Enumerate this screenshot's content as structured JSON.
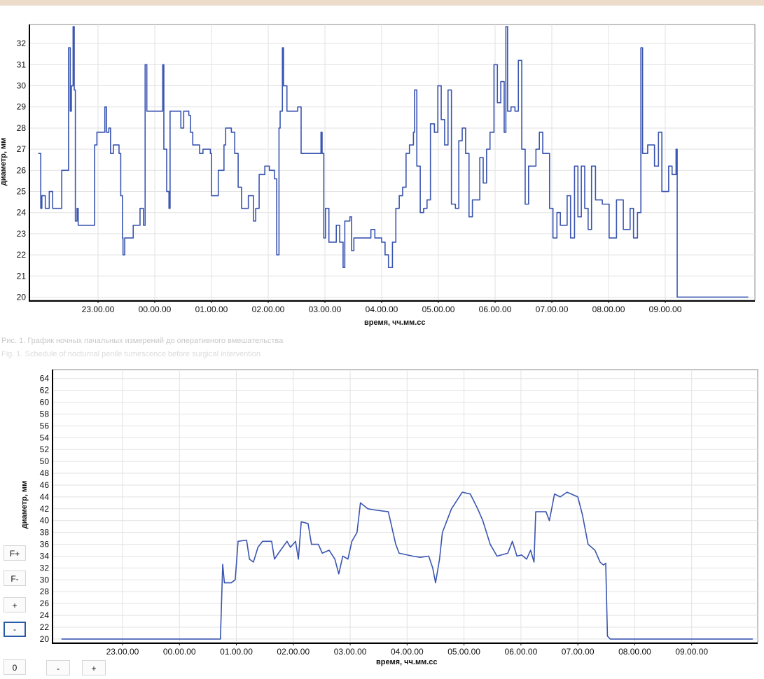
{
  "captions": {
    "ru": "Рис. 1. График ночных пачальных измерений до оперативного вмешательства",
    "en": "Fig. 1. Schedule of nocturnal penile tumescence before surgical intervention"
  },
  "controls": {
    "f_plus": "F+",
    "f_minus": "F-",
    "plus": "+",
    "minus": "-",
    "zero": "0",
    "x_minus": "-",
    "x_plus": "+"
  },
  "colors": {
    "line": "#3a55b0",
    "grid": "#e2e2e2",
    "topbar": "#eedccb"
  },
  "chart_data": [
    {
      "type": "line",
      "title": "",
      "xlabel": "время, чч.мм.сс",
      "ylabel": "диаметр, мм",
      "x_unit": "hours relative to 23:00",
      "xlim": [
        -1.21,
        11.58
      ],
      "ylim": [
        19.85,
        32.9
      ],
      "grid": true,
      "xticks": [
        0,
        1,
        2,
        3,
        4,
        5,
        6,
        7,
        8,
        9,
        10
      ],
      "xtick_labels": [
        "23.00.00",
        "00.00.00",
        "01.00.00",
        "02.00.00",
        "03.00.00",
        "04.00.00",
        "05.00.00",
        "06.00.00",
        "07.00.00",
        "08.00.00",
        "09.00.00"
      ],
      "yticks": [
        20,
        21,
        22,
        23,
        24,
        25,
        26,
        27,
        28,
        29,
        30,
        31,
        32
      ],
      "ytick_labels": [
        "20",
        "21",
        "22",
        "23",
        "24",
        "25",
        "26",
        "27",
        "28",
        "29",
        "30",
        "31",
        "32"
      ],
      "series": [
        {
          "name": "diameter",
          "x": [
            -1.05,
            -1.01,
            -0.99,
            -0.93,
            -0.86,
            -0.8,
            -0.68,
            -0.64,
            -0.56,
            -0.52,
            -0.49,
            -0.47,
            -0.44,
            -0.42,
            -0.4,
            -0.37,
            -0.35,
            -0.09,
            -0.06,
            -0.02,
            0.12,
            0.15,
            0.19,
            0.22,
            0.27,
            0.37,
            0.4,
            0.43,
            0.44,
            0.47,
            0.62,
            0.74,
            0.8,
            0.83,
            0.86,
            1.11,
            1.14,
            1.16,
            1.21,
            1.25,
            1.27,
            1.42,
            1.46,
            1.51,
            1.6,
            1.63,
            1.67,
            1.79,
            1.85,
            1.98,
            2.0,
            2.07,
            2.12,
            2.22,
            2.25,
            2.35,
            2.41,
            2.47,
            2.53,
            2.65,
            2.74,
            2.78,
            2.84,
            2.94,
            3.02,
            3.11,
            3.15,
            3.19,
            3.21,
            3.25,
            3.27,
            3.33,
            3.46,
            3.52,
            3.58,
            3.89,
            3.93,
            3.95,
            3.98,
            4.01,
            4.07,
            4.2,
            4.26,
            4.32,
            4.35,
            4.44,
            4.47,
            4.51,
            4.69,
            4.81,
            4.88,
            5.0,
            5.06,
            5.12,
            5.19,
            5.25,
            5.31,
            5.37,
            5.43,
            5.49,
            5.56,
            5.58,
            5.62,
            5.68,
            5.74,
            5.8,
            5.86,
            5.93,
            5.99,
            6.05,
            6.11,
            6.17,
            6.23,
            6.3,
            6.36,
            6.42,
            6.48,
            6.54,
            6.6,
            6.73,
            6.79,
            6.85,
            6.91,
            6.98,
            7.04,
            7.1,
            7.16,
            7.19,
            7.22,
            7.28,
            7.35,
            7.41,
            7.47,
            7.53,
            7.59,
            7.72,
            7.78,
            7.84,
            7.9,
            7.96,
            8.02,
            8.09,
            8.15,
            8.27,
            8.33,
            8.4,
            8.46,
            8.52,
            8.58,
            8.64,
            8.7,
            8.77,
            8.89,
            9.01,
            9.14,
            9.26,
            9.38,
            9.44,
            9.51,
            9.57,
            9.6,
            9.69,
            9.81,
            9.88,
            9.94,
            10.06,
            10.12,
            10.19,
            10.21,
            11.46
          ],
          "y": [
            26.8,
            24.2,
            24.8,
            24.2,
            25,
            24.2,
            24.2,
            26,
            26,
            31.8,
            28.8,
            30,
            32.8,
            29.8,
            23.6,
            24.2,
            23.4,
            23.4,
            27.2,
            27.8,
            29,
            27.8,
            28,
            26.8,
            27.2,
            26.8,
            24.8,
            22.8,
            22,
            22.8,
            23.4,
            24.2,
            23.4,
            31,
            28.8,
            28.8,
            31,
            27,
            25,
            24.2,
            28.8,
            28.8,
            28,
            28.8,
            28.6,
            27.8,
            27.2,
            26.8,
            27,
            26.8,
            24.8,
            24.8,
            26,
            27.2,
            28,
            27.8,
            26.8,
            25.2,
            24.2,
            24.8,
            23.6,
            24.2,
            25.8,
            26.2,
            26,
            25.6,
            22,
            28,
            28.8,
            31.8,
            30,
            28.8,
            28.8,
            29,
            26.8,
            26.8,
            27.8,
            26.8,
            22.8,
            24.2,
            22.6,
            23.4,
            22.6,
            21.4,
            23.6,
            23.8,
            22.2,
            22.8,
            22.8,
            23.2,
            22.8,
            22.6,
            22,
            21.4,
            22.6,
            24.2,
            24.8,
            25.2,
            26.8,
            27.2,
            27.8,
            29.8,
            26.2,
            24,
            24.2,
            24.6,
            28.2,
            27.8,
            30,
            28.4,
            27.2,
            29.8,
            24.4,
            24.2,
            27.4,
            28,
            26.8,
            23.8,
            24.6,
            26.6,
            25.4,
            27,
            27.8,
            31,
            29.2,
            30.2,
            27.8,
            32.8,
            28.8,
            29,
            28.8,
            31.2,
            27,
            24.4,
            26.2,
            27,
            27.8,
            26.8,
            26.8,
            24.2,
            22.8,
            24,
            23.4,
            24.8,
            22.8,
            26.2,
            23.8,
            26.2,
            24.2,
            23.2,
            26.2,
            24.6,
            24.4,
            22.8,
            24.6,
            23.2,
            24.2,
            22.8,
            24,
            31.8,
            26.8,
            27.2,
            26.2,
            27.8,
            25,
            26.2,
            25.8,
            27,
            20,
            20
          ]
        }
      ]
    },
    {
      "type": "line",
      "title": "",
      "xlabel": "время, чч.мм.сс",
      "ylabel": "диаметр, мм",
      "x_unit": "hours relative to 23:00",
      "xlim": [
        -1.23,
        11.16
      ],
      "ylim": [
        19.4,
        65.5
      ],
      "grid": true,
      "xticks": [
        0,
        1,
        2,
        3,
        4,
        5,
        6,
        7,
        8,
        9,
        10
      ],
      "xtick_labels": [
        "23.00.00",
        "00.00.00",
        "01.00.00",
        "02.00.00",
        "03.00.00",
        "04.00.00",
        "05.00.00",
        "06.00.00",
        "07.00.00",
        "08.00.00",
        "09.00.00"
      ],
      "yticks": [
        20,
        22,
        24,
        26,
        28,
        30,
        32,
        34,
        36,
        38,
        40,
        42,
        44,
        46,
        48,
        50,
        52,
        54,
        56,
        58,
        60,
        62,
        64
      ],
      "ytick_labels": [
        "20",
        "22",
        "24",
        "26",
        "28",
        "30",
        "32",
        "34",
        "36",
        "38",
        "40",
        "42",
        "44",
        "46",
        "48",
        "50",
        "52",
        "54",
        "56",
        "58",
        "60",
        "62",
        "64"
      ],
      "series": [
        {
          "name": "diameter",
          "x": [
            -1.07,
            1.72,
            1.76,
            1.79,
            1.91,
            1.98,
            2.03,
            2.18,
            2.23,
            2.3,
            2.38,
            2.46,
            2.62,
            2.67,
            2.74,
            2.89,
            2.95,
            3.04,
            3.09,
            3.14,
            3.26,
            3.32,
            3.44,
            3.51,
            3.63,
            3.73,
            3.8,
            3.87,
            3.96,
            4.03,
            4.12,
            4.18,
            4.31,
            4.43,
            4.67,
            4.8,
            4.86,
            5.1,
            5.23,
            5.38,
            5.45,
            5.5,
            5.57,
            5.62,
            5.78,
            5.97,
            6.11,
            6.24,
            6.33,
            6.46,
            6.58,
            6.77,
            6.85,
            6.93,
            7.01,
            7.1,
            7.17,
            7.23,
            7.26,
            7.44,
            7.5,
            7.59,
            7.69,
            7.81,
            8.0,
            8.08,
            8.18,
            8.3,
            8.39,
            8.45,
            8.49,
            8.52,
            8.57,
            11.07
          ],
          "y": [
            20,
            20,
            32.6,
            29.5,
            29.5,
            30,
            36.5,
            36.7,
            33.5,
            33,
            35.5,
            36.5,
            36.5,
            33.5,
            34.5,
            36.5,
            35.5,
            36.5,
            33.5,
            39.8,
            39.5,
            36,
            36,
            34.5,
            35,
            33.5,
            31,
            34,
            33.5,
            36.5,
            38,
            43,
            42,
            41.8,
            41.5,
            36,
            34.5,
            34,
            33.8,
            34,
            32,
            29.5,
            33.5,
            38,
            42,
            44.8,
            44.5,
            42,
            40,
            36,
            34,
            34.5,
            36.5,
            34,
            34.2,
            33.5,
            35,
            33,
            41.5,
            41.5,
            40,
            44.5,
            44,
            44.8,
            44,
            41,
            36,
            35,
            33,
            32.5,
            32.8,
            20.5,
            20,
            20
          ]
        }
      ]
    }
  ]
}
